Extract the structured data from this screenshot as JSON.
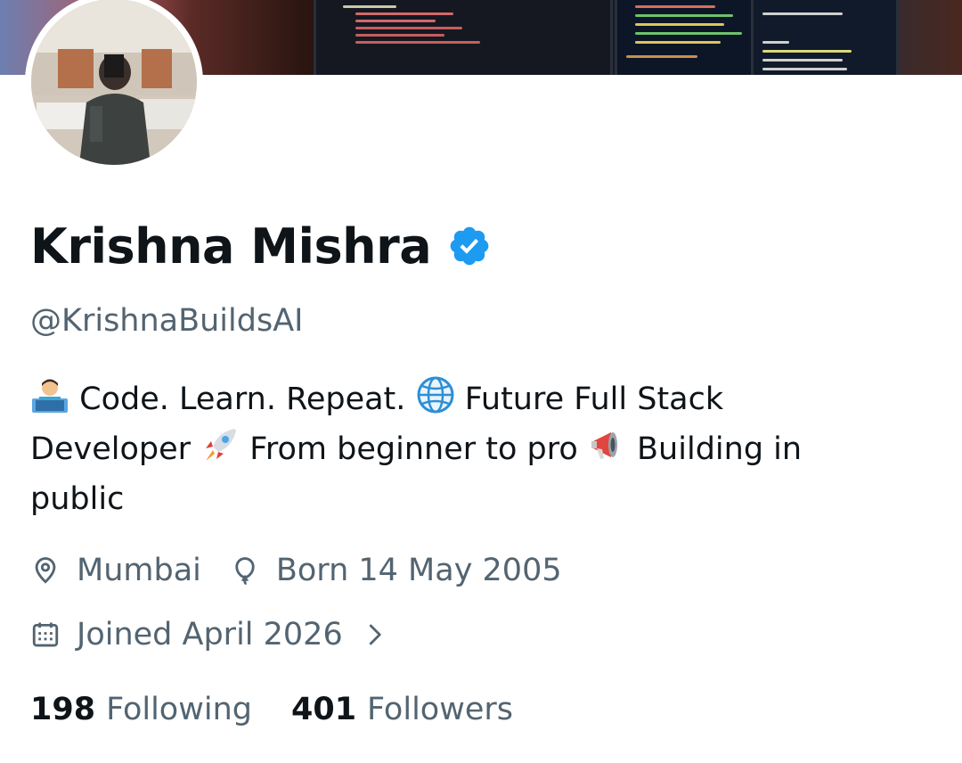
{
  "profile": {
    "display_name": "Krishna Mishra",
    "verified": true,
    "handle": "@KrishnaBuildsAI"
  },
  "bio": {
    "line1": [
      {
        "icon": "technologist-emoji"
      },
      {
        "text": " Code. Learn. Repeat. "
      },
      {
        "icon": "globe-emoji"
      },
      {
        "text": " Future Full Stack"
      }
    ],
    "segments": {
      "part1": "Code. Learn. Repeat.",
      "part2": "Future Full Stack",
      "part3": "Developer",
      "part4": "From beginner to pro",
      "part5": "Building in",
      "part6": "public"
    }
  },
  "meta": {
    "location": "Mumbai",
    "birthday": "Born 14 May 2005",
    "joined": "Joined April 2026"
  },
  "stats": {
    "following_count": "198",
    "following_label": "Following",
    "followers_count": "401",
    "followers_label": "Followers"
  },
  "colors": {
    "text_primary": "#0f1419",
    "text_secondary": "#536471",
    "verified_blue": "#1d9bf0"
  },
  "icons": [
    "location-pin-icon",
    "birthday-balloon-icon",
    "calendar-icon",
    "chevron-right-icon",
    "verified-badge-icon"
  ]
}
